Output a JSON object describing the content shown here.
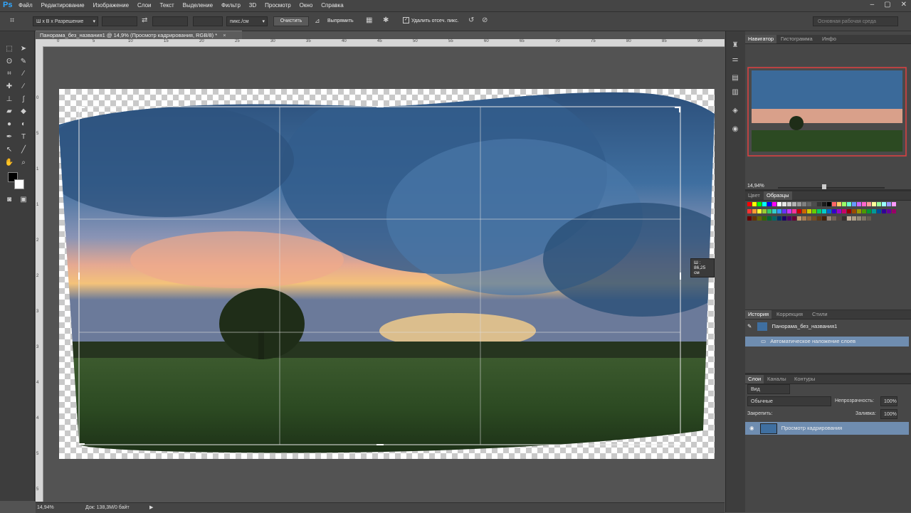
{
  "app": {
    "logo": "Ps",
    "menu": [
      "Файл",
      "Редактирование",
      "Изображение",
      "Слои",
      "Текст",
      "Выделение",
      "Фильтр",
      "3D",
      "Просмотр",
      "Окно",
      "Справка"
    ],
    "window_controls": [
      "–",
      "▢",
      "✕"
    ]
  },
  "options": {
    "ratio_select": "Ш x В x Разрешение",
    "units_select": "пикс./см",
    "clear_button": "Очистить",
    "straighten": "Выпрямить",
    "delete_cropped_label": "Удалить отсеч. пикс.",
    "workspace": "Основная рабочая среда"
  },
  "document": {
    "tab_title": "Панорама_без_названия1 @ 14,9% (Просмотр кадрирования, RGB/8) *",
    "ruler_top": [
      "0",
      "5",
      "10",
      "15",
      "20",
      "25",
      "30",
      "35",
      "40",
      "45",
      "50",
      "55",
      "60",
      "65",
      "70",
      "75",
      "80",
      "85",
      "90"
    ],
    "ruler_left": [
      "0",
      "5",
      "1",
      "1",
      "2",
      "2",
      "3",
      "3",
      "4",
      "4",
      "5",
      "5"
    ],
    "crop_tooltip": "Ш : 86,25 см"
  },
  "status": {
    "zoom": "14,94%",
    "doc_info": "Док: 138,3М/0 байт"
  },
  "navigator": {
    "tabs": [
      "Навигатор",
      "Гистограмма",
      "Инфо"
    ],
    "zoom": "14,94%"
  },
  "swatches": {
    "tabs": [
      "Цвет",
      "Образцы"
    ],
    "row1": [
      "#ff0000",
      "#ffff00",
      "#00ff00",
      "#00ffff",
      "#0000ff",
      "#ff00ff",
      "#ffffff",
      "#e6e6e6",
      "#cccccc",
      "#b3b3b3",
      "#999999",
      "#808080",
      "#666666",
      "#4d4d4d",
      "#333333",
      "#1a1a1a",
      "#000000",
      "#ff6666",
      "#ffcc66",
      "#99ff66",
      "#66ffcc",
      "#6699ff",
      "#cc66ff",
      "#ff66cc",
      "#ff9999",
      "#ffff99",
      "#99ff99",
      "#99ffff",
      "#9999ff",
      "#ff99ff"
    ],
    "row2": [
      "#ff3333",
      "#ff9933",
      "#ffff33",
      "#99cc33",
      "#33cc66",
      "#33cccc",
      "#3399ff",
      "#6633ff",
      "#cc33ff",
      "#ff3399",
      "#cc0000",
      "#cc6600",
      "#cccc00",
      "#66cc00",
      "#00cc66",
      "#00cccc",
      "#0066cc",
      "#3300cc",
      "#9900cc",
      "#cc0066",
      "#990000",
      "#994c00",
      "#999900",
      "#4c9900",
      "#009933",
      "#009999",
      "#004c99",
      "#330099",
      "#660099",
      "#990066"
    ],
    "row3": [
      "#660000",
      "#663300",
      "#666600",
      "#336600",
      "#006633",
      "#006666",
      "#003366",
      "#1a0066",
      "#4d0066",
      "#660033",
      "#c69c6d",
      "#a67c52",
      "#8c6239",
      "#754c24",
      "#603913",
      "#42210b",
      "#998675",
      "#736357",
      "#534741",
      "#362f2d",
      "#c7b299",
      "#ad9e86",
      "#948a76",
      "#7d7363",
      "#645c4f"
    ]
  },
  "history": {
    "tabs": [
      "История",
      "Коррекция",
      "Стили"
    ],
    "snapshot": "Панорама_без_названия1",
    "items": [
      "Автоматическое наложение слоев"
    ]
  },
  "layers": {
    "tabs": [
      "Слои",
      "Каналы",
      "Контуры"
    ],
    "filter": "Вид",
    "blend": "Обычные",
    "opacity_label": "Непрозрачность:",
    "opacity": "100%",
    "lock_label": "Закрепить:",
    "fill_label": "Заливка:",
    "fill": "100%",
    "layer_name": "Просмотр кадрирования"
  },
  "colors": {
    "accent_selected": "#6f8db0",
    "panel_bg": "#474747"
  }
}
